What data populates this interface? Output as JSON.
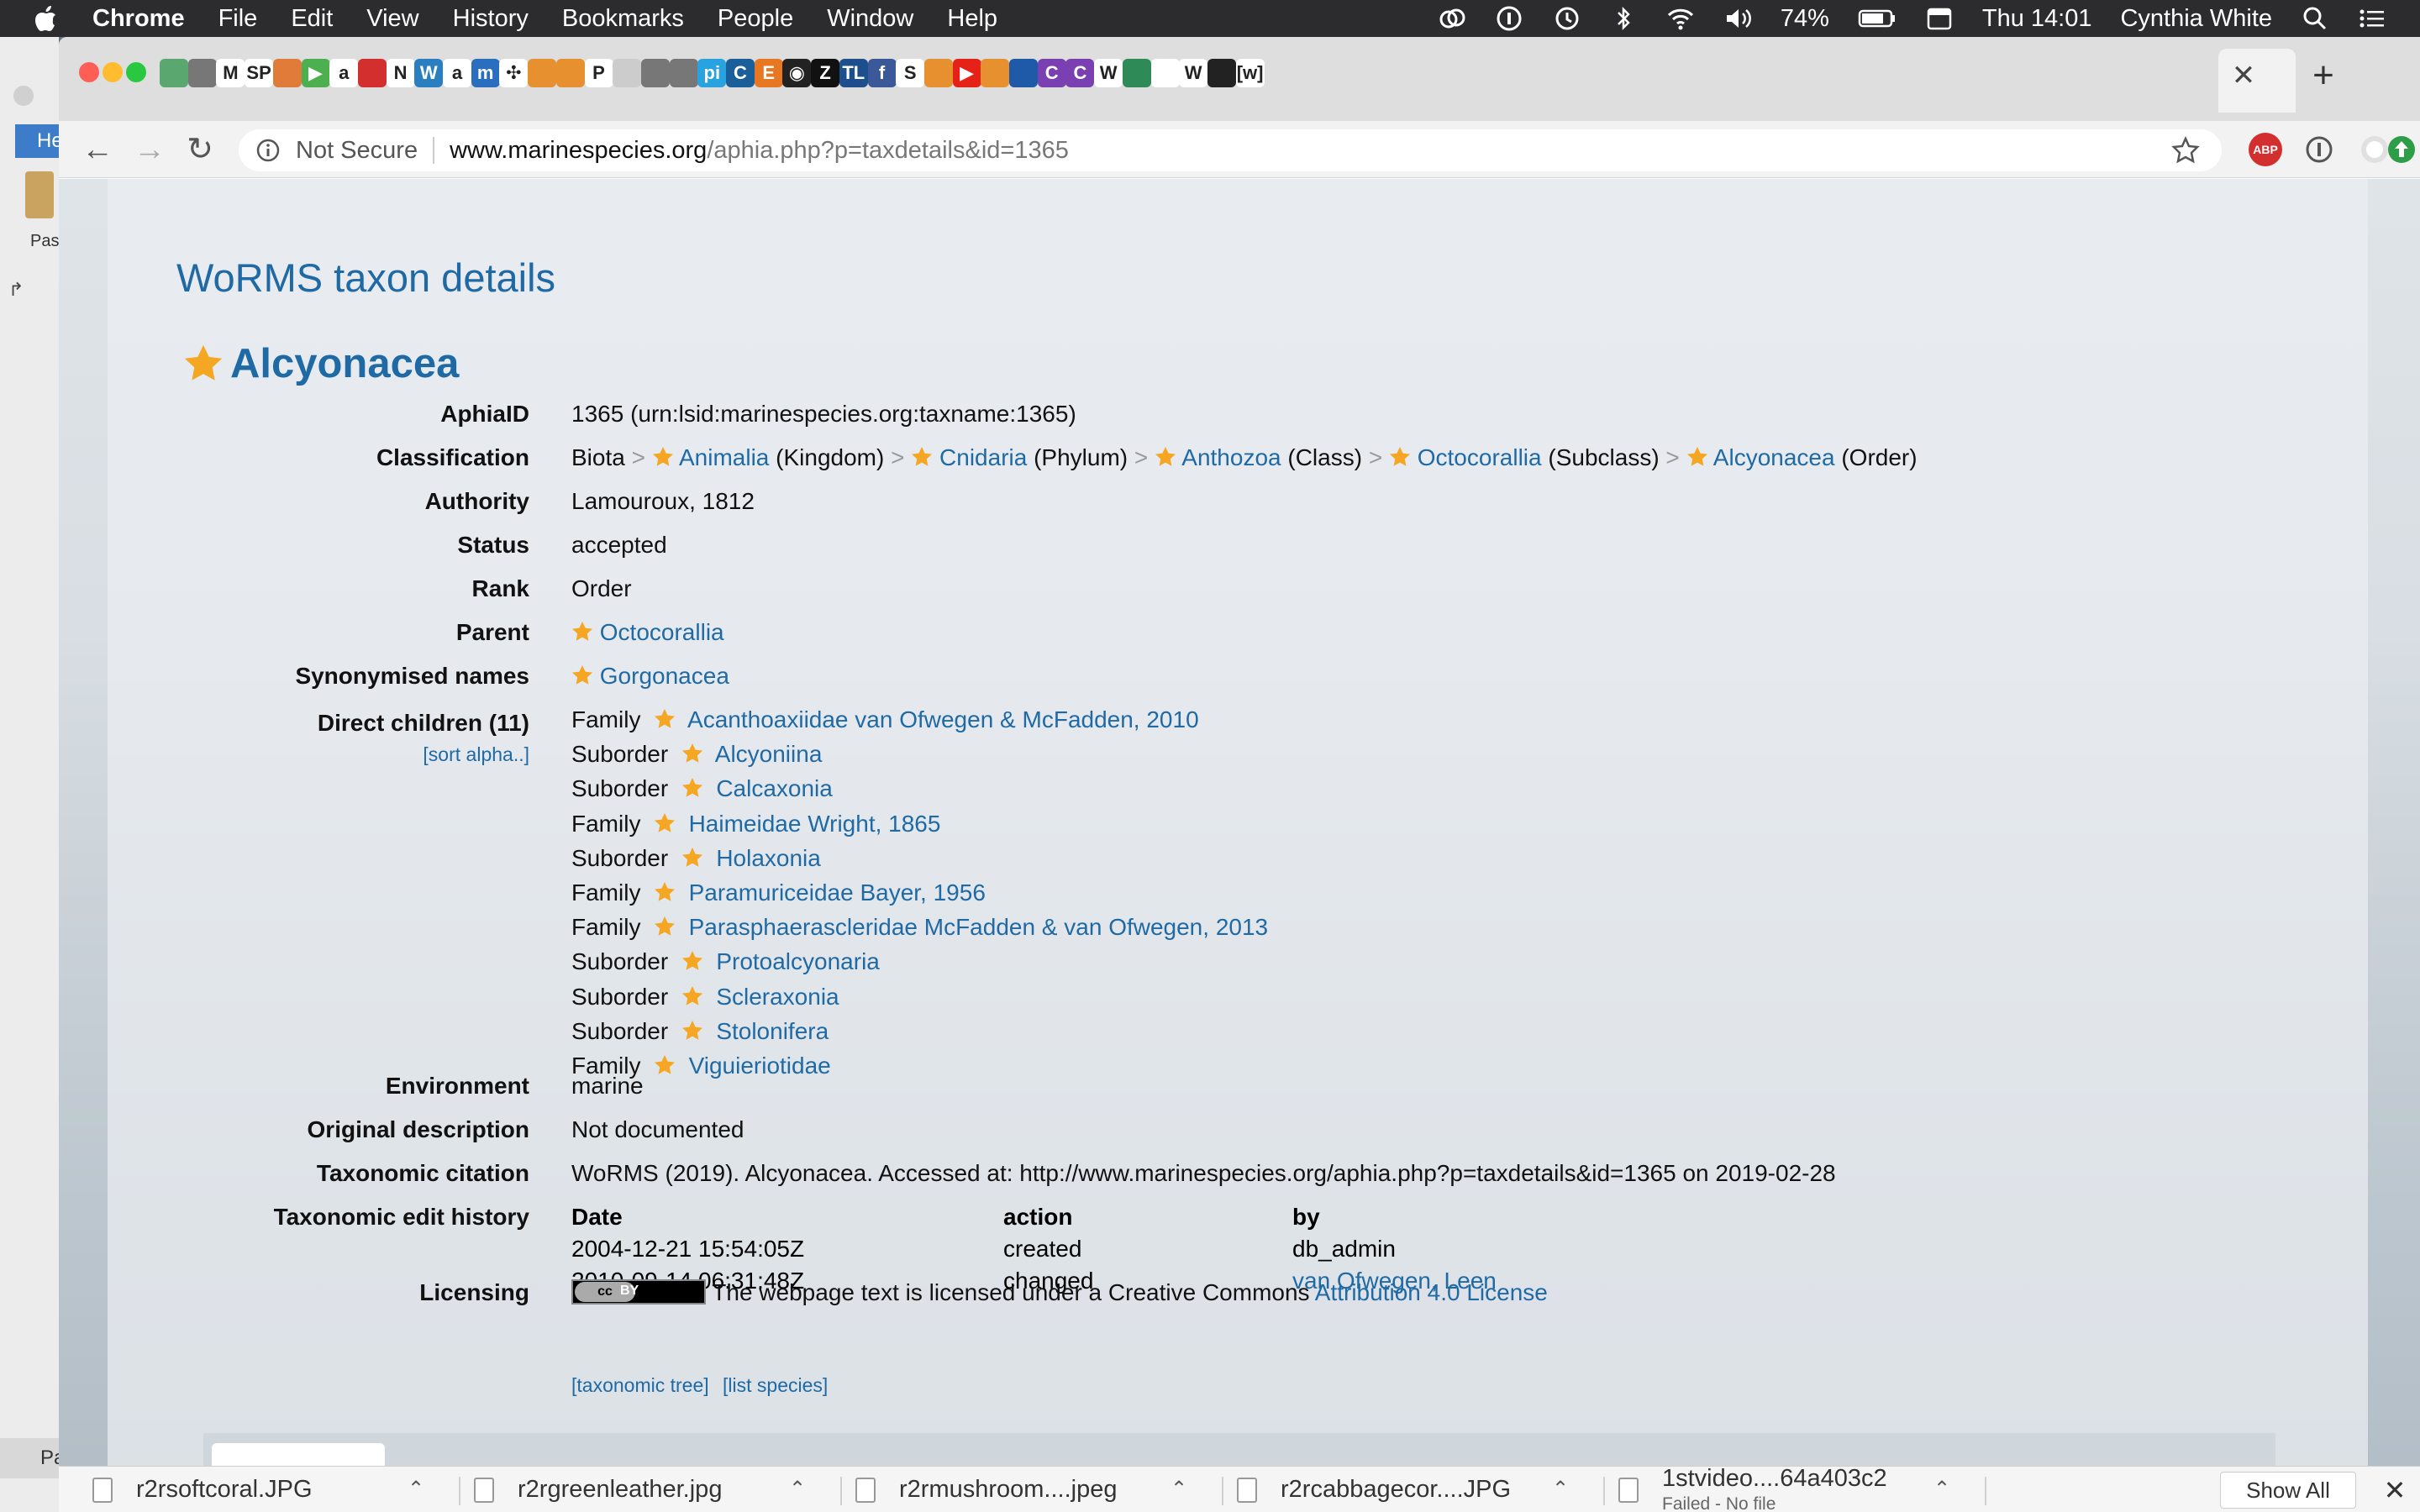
{
  "menubar": {
    "app_name": "Chrome",
    "menus": [
      "File",
      "Edit",
      "View",
      "History",
      "Bookmarks",
      "People",
      "Window",
      "Help"
    ],
    "battery": "74%",
    "clock": "Thu 14:01",
    "user": "Cynthia White"
  },
  "background_app": {
    "tab_label": "He",
    "paste_label": "Pas",
    "bottom_label": "Pa"
  },
  "browser": {
    "security_label": "Not Secure",
    "url_host": "www.marinespecies.org",
    "url_path": "/aphia.php?p=taxdetails&id=1365",
    "bookmark_tabs": [
      {
        "icon": "mountain-icon",
        "color": "#5aa870",
        "glyph": ""
      },
      {
        "icon": "globe-icon",
        "color": "#777777",
        "glyph": ""
      },
      {
        "icon": "gmail-icon",
        "color": "#ffffff",
        "glyph": "M"
      },
      {
        "icon": "sp-icon",
        "color": "#ffffff",
        "glyph": "SP"
      },
      {
        "icon": "swirl-icon",
        "color": "#e07b39",
        "glyph": ""
      },
      {
        "icon": "play-icon",
        "color": "#4caf50",
        "glyph": "▶"
      },
      {
        "icon": "amazon-icon",
        "color": "#ffffff",
        "glyph": "a"
      },
      {
        "icon": "book-red-icon",
        "color": "#d32f2f",
        "glyph": ""
      },
      {
        "icon": "netflix-icon",
        "color": "#ffffff",
        "glyph": "N"
      },
      {
        "icon": "wordpress-icon",
        "color": "#2a7fc1",
        "glyph": "W"
      },
      {
        "icon": "amazon-icon",
        "color": "#ffffff",
        "glyph": "a"
      },
      {
        "icon": "m-icon",
        "color": "#2a6ebf",
        "glyph": "m"
      },
      {
        "icon": "grid-icon",
        "color": "#ffffff",
        "glyph": "✣"
      },
      {
        "icon": "stack-icon",
        "color": "#e6902f",
        "glyph": ""
      },
      {
        "icon": "stack-icon",
        "color": "#e6902f",
        "glyph": ""
      },
      {
        "icon": "p-icon",
        "color": "#ffffff",
        "glyph": "P"
      },
      {
        "icon": "circle-icon",
        "color": "#cccccc",
        "glyph": ""
      },
      {
        "icon": "figure-icon",
        "color": "#777777",
        "glyph": ""
      },
      {
        "icon": "figure-icon",
        "color": "#777777",
        "glyph": ""
      },
      {
        "icon": "pi-icon",
        "color": "#29a3e0",
        "glyph": "pi"
      },
      {
        "icon": "c-icon",
        "color": "#1a5f99",
        "glyph": "C"
      },
      {
        "icon": "e-icon",
        "color": "#e87722",
        "glyph": "E"
      },
      {
        "icon": "target-icon",
        "color": "#222222",
        "glyph": "◉"
      },
      {
        "icon": "z-icon",
        "color": "#111111",
        "glyph": "Z"
      },
      {
        "icon": "tl-icon",
        "color": "#1c4f8c",
        "glyph": "TL"
      },
      {
        "icon": "facebook-icon",
        "color": "#3b5998",
        "glyph": "f"
      },
      {
        "icon": "s-icon",
        "color": "#ffffff",
        "glyph": "S"
      },
      {
        "icon": "stack-icon",
        "color": "#e6902f",
        "glyph": ""
      },
      {
        "icon": "youtube-icon",
        "color": "#e62117",
        "glyph": "▶"
      },
      {
        "icon": "stack-icon",
        "color": "#e6902f",
        "glyph": ""
      },
      {
        "icon": "noaa-icon",
        "color": "#1e5aa8",
        "glyph": ""
      },
      {
        "icon": "c-purple-icon",
        "color": "#7a3fb0",
        "glyph": "C"
      },
      {
        "icon": "c-purple-icon",
        "color": "#7a3fb0",
        "glyph": "C"
      },
      {
        "icon": "wikipedia-icon",
        "color": "#ffffff",
        "glyph": "W"
      },
      {
        "icon": "grid-green-icon",
        "color": "#2e8b57",
        "glyph": ""
      },
      {
        "icon": "document-icon",
        "color": "#ffffff",
        "glyph": ""
      },
      {
        "icon": "wikipedia-icon",
        "color": "#ffffff",
        "glyph": "W"
      },
      {
        "icon": "paw-icon",
        "color": "#222222",
        "glyph": ""
      },
      {
        "icon": "worms-icon",
        "color": "#ffffff",
        "glyph": "[w]"
      }
    ]
  },
  "page": {
    "title": "WoRMS taxon details",
    "taxon_name": "Alcyonacea",
    "fields": {
      "aphiaid_label": "AphiaID",
      "aphiaid_value": "1365  (urn:lsid:marinespecies.org:taxname:1365)",
      "classification_label": "Classification",
      "classification_root": "Biota",
      "classification": [
        {
          "name": "Animalia",
          "rank": "(Kingdom)"
        },
        {
          "name": "Cnidaria",
          "rank": "(Phylum)"
        },
        {
          "name": "Anthozoa",
          "rank": "(Class)"
        },
        {
          "name": "Octocorallia",
          "rank": "(Subclass)"
        },
        {
          "name": "Alcyonacea",
          "rank": "(Order)"
        }
      ],
      "authority_label": "Authority",
      "authority_value": "Lamouroux, 1812",
      "status_label": "Status",
      "status_value": "accepted",
      "rank_label": "Rank",
      "rank_value": "Order",
      "parent_label": "Parent",
      "parent_value": "Octocorallia",
      "synonymised_label": "Synonymised names",
      "synonymised_value": "Gorgonacea",
      "children_label": "Direct children (11)",
      "sort_link": "[sort alpha..]",
      "environment_label": "Environment",
      "environment_value": "marine",
      "original_desc_label": "Original description",
      "original_desc_value": "Not documented",
      "citation_label": "Taxonomic citation",
      "citation_value": "WoRMS (2019). Alcyonacea. Accessed at: http://www.marinespecies.org/aphia.php?p=taxdetails&id=1365 on 2019-02-28",
      "history_label": "Taxonomic edit history",
      "licensing_label": "Licensing",
      "licensing_text": "The webpage text is licensed under a Creative Commons",
      "licensing_link": "Attribution 4.0 License",
      "cc_badge_cc": "cc",
      "cc_badge_by": "BY"
    },
    "children": [
      {
        "rank": "Family",
        "name": "Acanthoaxiidae van Ofwegen & McFadden, 2010"
      },
      {
        "rank": "Suborder",
        "name": "Alcyoniina"
      },
      {
        "rank": "Suborder",
        "name": "Calcaxonia"
      },
      {
        "rank": "Family",
        "name": "Haimeidae Wright, 1865"
      },
      {
        "rank": "Suborder",
        "name": "Holaxonia"
      },
      {
        "rank": "Family",
        "name": "Paramuriceidae Bayer, 1956"
      },
      {
        "rank": "Family",
        "name": "Parasphaerascleridae McFadden & van Ofwegen, 2013"
      },
      {
        "rank": "Suborder",
        "name": "Protoalcyonaria"
      },
      {
        "rank": "Suborder",
        "name": "Scleraxonia"
      },
      {
        "rank": "Suborder",
        "name": "Stolonifera"
      },
      {
        "rank": "Family",
        "name": "Viguieriotidae"
      }
    ],
    "history": {
      "headers": [
        "Date",
        "action",
        "by"
      ],
      "rows": [
        {
          "date": "2004-12-21 15:54:05Z",
          "action": "created",
          "by": "db_admin",
          "by_is_link": false
        },
        {
          "date": "2010-09-14 06:31:48Z",
          "action": "changed",
          "by": "van Ofwegen, Leen",
          "by_is_link": true
        }
      ]
    },
    "bottom_links": [
      "[taxonomic tree]",
      "[list species]"
    ]
  },
  "downloads": {
    "items": [
      {
        "name": "r2rsoftcoral.JPG",
        "sub": ""
      },
      {
        "name": "r2rgreenleather.jpg",
        "sub": ""
      },
      {
        "name": "r2rmushroom....jpeg",
        "sub": ""
      },
      {
        "name": "r2rcabbagecor....JPG",
        "sub": ""
      },
      {
        "name": "1stvideo....64a403c2",
        "sub": "Failed - No file"
      }
    ],
    "show_all": "Show All"
  },
  "colors": {
    "link": "#1f6aa5",
    "star": "#f5a623"
  }
}
